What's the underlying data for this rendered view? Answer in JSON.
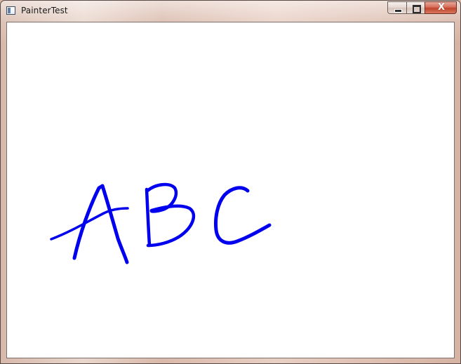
{
  "window": {
    "title": "PainterTest"
  },
  "caption_buttons": {
    "close_glyph": "X"
  },
  "canvas": {
    "background": "#ffffff",
    "stroke_color": "#0000ee",
    "drawn_text": "ABC"
  },
  "icons": {
    "app": "app-window-icon",
    "minimize": "minimize-icon",
    "maximize": "maximize-icon",
    "close": "close-icon"
  }
}
